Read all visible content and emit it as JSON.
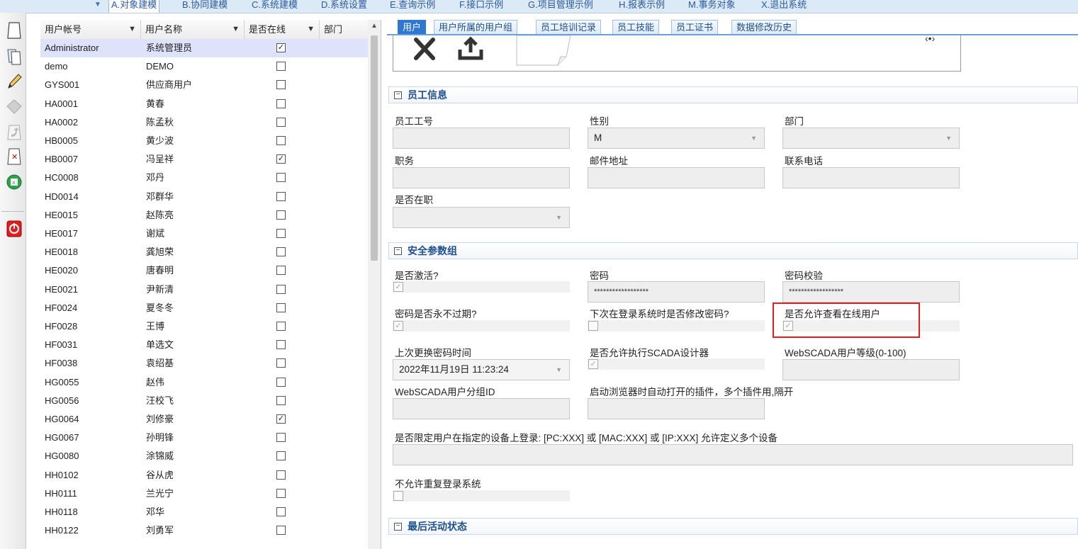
{
  "menu": {
    "items": [
      {
        "label": "A.对象建模",
        "active": true
      },
      {
        "label": "B.协同建模"
      },
      {
        "label": "C.系统建模"
      },
      {
        "label": "D.系统设置"
      },
      {
        "label": "E.查询示例"
      },
      {
        "label": "F.接口示例"
      },
      {
        "label": "G.项目管理示例"
      },
      {
        "label": "H.报表示例"
      },
      {
        "label": "M.事务对象"
      },
      {
        "label": "X.退出系统"
      }
    ]
  },
  "toolbar": {
    "icons": [
      "new-document-icon",
      "copy-document-icon",
      "edit-pencil-icon",
      "save-disk-icon",
      "undo-icon",
      "delete-document-icon",
      "export-excel-icon",
      "power-exit-icon"
    ]
  },
  "user_list": {
    "columns": [
      "用户帐号",
      "用户名称",
      "是否在线",
      "部门"
    ],
    "filter_glyph": "▼",
    "rows": [
      {
        "account": "Administrator",
        "name": "系统管理员",
        "online": true,
        "selected": true
      },
      {
        "account": "demo",
        "name": "DEMO",
        "online": false
      },
      {
        "account": "GYS001",
        "name": "供应商用户",
        "online": false
      },
      {
        "account": "HA0001",
        "name": "黄春",
        "online": false
      },
      {
        "account": "HA0002",
        "name": "陈孟秋",
        "online": false
      },
      {
        "account": "HB0005",
        "name": "黄少波",
        "online": false
      },
      {
        "account": "HB0007",
        "name": "冯呈祥",
        "online": true
      },
      {
        "account": "HC0008",
        "name": "邓丹",
        "online": false
      },
      {
        "account": "HD0014",
        "name": "邓群华",
        "online": false
      },
      {
        "account": "HE0015",
        "name": "赵陈亮",
        "online": false
      },
      {
        "account": "HE0017",
        "name": "谢斌",
        "online": false
      },
      {
        "account": "HE0018",
        "name": "龚旭荣",
        "online": false
      },
      {
        "account": "HE0020",
        "name": "唐春明",
        "online": false
      },
      {
        "account": "HE0021",
        "name": "尹新清",
        "online": false
      },
      {
        "account": "HF0024",
        "name": "夏冬冬",
        "online": false
      },
      {
        "account": "HF0028",
        "name": "王博",
        "online": false
      },
      {
        "account": "HF0031",
        "name": "单选文",
        "online": false
      },
      {
        "account": "HF0038",
        "name": "袁绍基",
        "online": false
      },
      {
        "account": "HG0055",
        "name": "赵伟",
        "online": false
      },
      {
        "account": "HG0056",
        "name": "汪校飞",
        "online": false
      },
      {
        "account": "HG0064",
        "name": "刘修豪",
        "online": true
      },
      {
        "account": "HG0067",
        "name": "孙明锋",
        "online": false
      },
      {
        "account": "HG0080",
        "name": "涂锦威",
        "online": false
      },
      {
        "account": "HH0102",
        "name": "谷从虎",
        "online": false
      },
      {
        "account": "HH0111",
        "name": "兰光宁",
        "online": false
      },
      {
        "account": "HH0118",
        "name": "邓华",
        "online": false
      },
      {
        "account": "HH0122",
        "name": "刘勇军",
        "online": false
      }
    ]
  },
  "tabs": [
    "用户",
    "用户所属的用户组",
    "员工培训记录",
    "员工技能",
    "员工证书",
    "数据修改历史"
  ],
  "photo": {
    "delete_icon": "close-x-icon",
    "upload_icon": "upload-icon"
  },
  "sections": {
    "employee": {
      "title": "员工信息",
      "employee_no_label": "员工工号",
      "employee_no_value": "",
      "gender_label": "性别",
      "gender_value": "M",
      "dept_label": "部门",
      "dept_value": "",
      "position_label": "职务",
      "email_label": "邮件地址",
      "phone_label": "联系电话",
      "employed_label": "是否在职"
    },
    "security": {
      "title": "安全参数组",
      "active_label": "是否激活?",
      "active_checked": true,
      "password_label": "密码",
      "password_value": "******************",
      "password_check_label": "密码校验",
      "password_check_value": "******************",
      "never_expire_label": "密码是否永不过期?",
      "never_expire_checked": true,
      "change_next_login_label": "下次在登录系统时是否修改密码?",
      "change_next_login_checked": false,
      "view_online_label": "是否允许查看在线用户",
      "view_online_checked": true,
      "last_pwd_change_label": "上次更换密码时间",
      "last_pwd_change_value": "2022年11月19日 11:23:24",
      "scada_designer_label": "是否允许执行SCADA设计器",
      "scada_designer_checked": true,
      "webscada_level_label": "WebSCADA用户等级(0-100)",
      "webscada_group_label": "WebSCADA用户分组ID",
      "auto_plugins_label": "启动浏览器时自动打开的插件，多个插件用,隔开",
      "device_restrict_label": "是否限定用户在指定的设备上登录: [PC:XXX] 或 [MAC:XXX] 或 [IP:XXX] 允许定义多个设备",
      "no_repeat_login_label": "不允许重复登录系统",
      "no_repeat_login_checked": false
    },
    "last_activity": {
      "title": "最后活动状态"
    }
  },
  "colors": {
    "accent": "#2f77d0",
    "highlight": "#e02020",
    "selected_row": "#dfe2fb"
  }
}
